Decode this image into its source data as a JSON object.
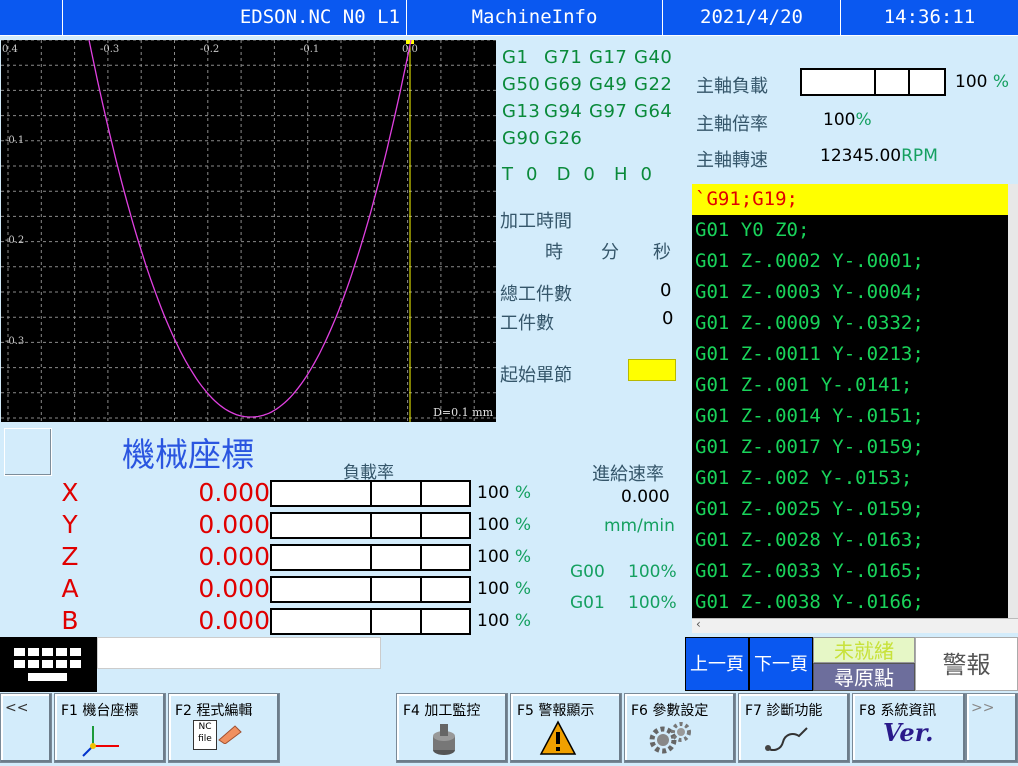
{
  "header": {
    "program": "EDSON.NC N0 L1",
    "screen": "MachineInfo",
    "date": "2021/4/20",
    "time": "14:36:11"
  },
  "plot": {
    "x_ticks": [
      "0.4",
      "-0.3",
      "-0.2",
      "-0.1",
      "0.0"
    ],
    "y_ticks": [
      "-0.1",
      "-0.2",
      "-0.3"
    ],
    "scale_label": "D=0.1 mm"
  },
  "modal_gcodes": [
    [
      "G1",
      "G71",
      "G17",
      "G40"
    ],
    [
      "G50",
      "G69",
      "G49",
      "G22"
    ],
    [
      "G13",
      "G94",
      "G97",
      "G64"
    ],
    [
      "G90",
      "G26"
    ]
  ],
  "tool": {
    "t_label": "T",
    "t": "0",
    "d_label": "D",
    "d": "0",
    "h_label": "H",
    "h": "0"
  },
  "machining": {
    "time_label": "加工時間",
    "hour": "時",
    "minute": "分",
    "second": "秒",
    "total_parts_label": "總工件數",
    "total_parts": "0",
    "parts_label": "工件數",
    "parts": "0",
    "start_block_label": "起始單節"
  },
  "spindle": {
    "load_label": "主軸負載",
    "load_pct": "100",
    "load_fraction": 1.0,
    "override_label": "主軸倍率",
    "override": "100",
    "speed_label": "主軸轉速",
    "speed": "12345.00",
    "speed_unit": "RPM",
    "pct_sign": "%"
  },
  "program_lines": [
    "`G91;G19;",
    "G01 Y0 Z0;",
    "G01 Z-.0002 Y-.0001;",
    "G01 Z-.0003 Y-.0004;",
    "G01 Z-.0009 Y-.0332;",
    "G01 Z-.0011 Y-.0213;",
    "G01 Z-.001 Y-.0141;",
    "G01 Z-.0014 Y-.0151;",
    "G01 Z-.0017 Y-.0159;",
    "G01 Z-.002 Y-.0153;",
    "G01 Z-.0025 Y-.0159;",
    "G01 Z-.0028 Y-.0163;",
    "G01 Z-.0033 Y-.0165;",
    "G01 Z-.0038 Y-.0166;"
  ],
  "coords": {
    "title": "機械座標",
    "load_label": "負載率",
    "axes": [
      {
        "name": "X",
        "value": "0.000",
        "load": "100"
      },
      {
        "name": "Y",
        "value": "0.000",
        "load": "100"
      },
      {
        "name": "Z",
        "value": "0.000",
        "load": "100"
      },
      {
        "name": "A",
        "value": "0.000",
        "load": "100"
      },
      {
        "name": "B",
        "value": "0.000",
        "load": "100"
      }
    ],
    "pct_sign": "%"
  },
  "feed": {
    "label": "進給速率",
    "value": "0.000",
    "unit": "mm/min",
    "g00_label": "G00",
    "g00": "100%",
    "g01_label": "G01",
    "g01": "100%"
  },
  "nav": {
    "prev_page": "上一頁",
    "next_page": "下一頁",
    "not_ready": "未就緒",
    "home_search": "尋原點",
    "alarm": "警報"
  },
  "fkeys": {
    "back": "<<",
    "f1": "F1 機台座標",
    "f2": "F2 程式編輯",
    "f4": "F4 加工監控",
    "f5": "F5 警報顯示",
    "f6": "F6 參數設定",
    "f7": "F7 診斷功能",
    "f8": "F8 系統資訊",
    "more": ">>",
    "f2_icon_text_1": "NC",
    "f2_icon_text_2": "file",
    "f8_icon_text": "Ver."
  },
  "colors": {
    "title_bar": "#0a58f0",
    "panel_bg": "#d3ecfb",
    "axis_red": "#e00000",
    "code_green": "#19d35a",
    "highlight": "#ffff00",
    "curve": "#e040e0"
  }
}
